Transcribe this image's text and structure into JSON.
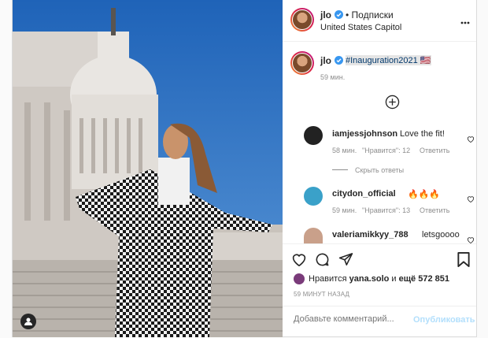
{
  "header": {
    "username": "jlo",
    "follow_label": "• Подписки",
    "location": "United States Capitol",
    "more_icon": "more-icon"
  },
  "caption": {
    "username": "jlo",
    "text": "#Inauguration2021 🇺🇸",
    "time": "59 мин."
  },
  "load_more_icon": "plus-circle-icon",
  "comments": [
    {
      "username": "iamjessjohnson",
      "text": "Love the fit!",
      "time": "58 мин.",
      "likes": "\"Нравится\": 12",
      "reply": "Ответить"
    },
    {
      "username": "citydon_official",
      "text": "🔥🔥🔥",
      "time": "59 мин.",
      "likes": "\"Нравится\": 13",
      "reply": "Ответить"
    },
    {
      "username": "valeriamikkyy_788",
      "text": "letsgoooo"
    }
  ],
  "hide_replies": "Скрыть ответы",
  "likes": {
    "prefix": "Нравится",
    "user": "yana.solo",
    "and": "и",
    "count": "ещё 572 851"
  },
  "timestamp": "59 МИНУТ НАЗАД",
  "add_comment": {
    "placeholder": "Добавьте комментарий...",
    "post_label": "Опубликовать"
  },
  "colors": {
    "link": "#00376b",
    "post_button": "#b2dffc",
    "sky": "#2f6fbf"
  }
}
